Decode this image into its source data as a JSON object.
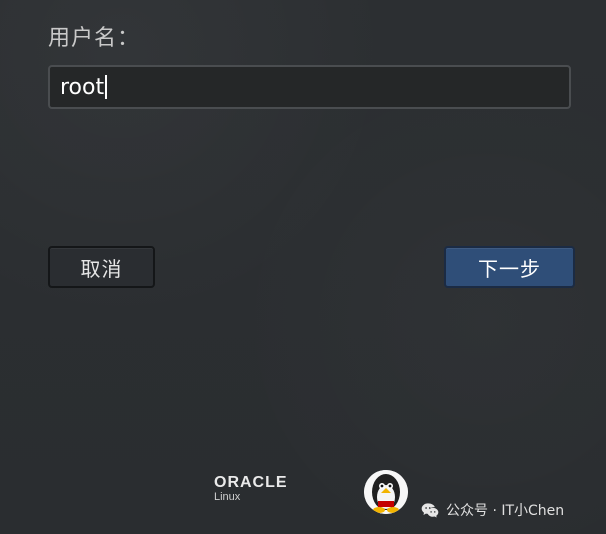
{
  "login": {
    "username_label": "用户名：",
    "username_value": "root"
  },
  "buttons": {
    "cancel": "取消",
    "next": "下一步"
  },
  "branding": {
    "oracle_word": "ORACLE",
    "oracle_product": "Linux"
  },
  "watermark": {
    "text": "公众号 · IT小Chen"
  },
  "colors": {
    "background": "#2b2e31",
    "primary_button": "#2f4e78",
    "input_bg": "#252728"
  },
  "icons": {
    "tux": "tux-icon",
    "wechat": "wechat-icon"
  }
}
